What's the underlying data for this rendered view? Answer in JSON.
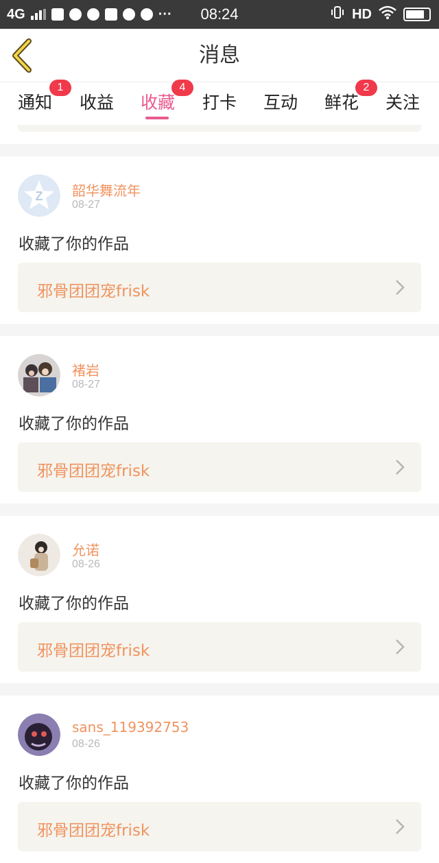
{
  "status": {
    "network": "4G",
    "time": "08:24",
    "more": "···",
    "hd": "HD"
  },
  "header": {
    "title": "消息"
  },
  "tabs": [
    {
      "label": "通知",
      "badge": "1"
    },
    {
      "label": "收益",
      "badge": ""
    },
    {
      "label": "收藏",
      "badge": "4"
    },
    {
      "label": "打卡",
      "badge": ""
    },
    {
      "label": "互动",
      "badge": ""
    },
    {
      "label": "鲜花",
      "badge": "2"
    },
    {
      "label": "关注",
      "badge": ""
    }
  ],
  "active_tab": "收藏",
  "notifications": [
    {
      "username": "韶华舞流年",
      "date": "08-27",
      "action": "收藏了你的作品",
      "work_title": "邪骨团团宠frisk",
      "avatar": "qq-star-avatar"
    },
    {
      "username": "褚岩",
      "date": "08-27",
      "action": "收藏了你的作品",
      "work_title": "邪骨团团宠frisk",
      "avatar": "anime-characters-avatar"
    },
    {
      "username": "允诺",
      "date": "08-26",
      "action": "收藏了你的作品",
      "work_title": "邪骨团团宠frisk",
      "avatar": "girl-photo-avatar"
    },
    {
      "username": "sans_119392753",
      "date": "08-26",
      "action": "收藏了你的作品",
      "work_title": "邪骨团团宠frisk",
      "avatar": "dark-character-avatar"
    }
  ],
  "colors": {
    "accent_pink": "#e95a8e",
    "name_orange": "#f0935f",
    "badge_red": "#f0394a",
    "statusbar": "#3a3a3a"
  }
}
